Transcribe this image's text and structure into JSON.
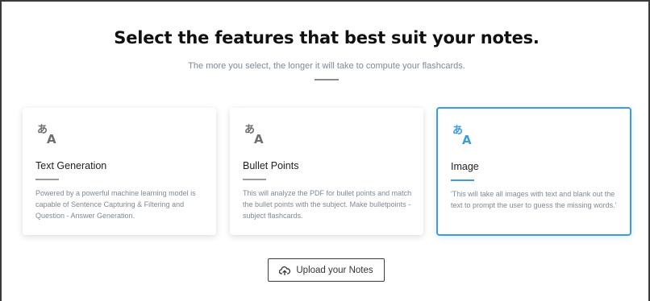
{
  "header": {
    "title": "Select the features that best suit your notes.",
    "subtitle": "The more you select, the longer it will take to compute your flashcards."
  },
  "features": [
    {
      "title": "Text Generation",
      "description": "Powered by a powerful machine learning model is capable of Sentence Capturing & Filtering and Question - Answer Generation.",
      "icon": "translate-icon",
      "selected": false
    },
    {
      "title": "Bullet Points",
      "description": "This will analyze the PDF for bullet points and match the bullet points with the subject. Make bulletpoints - subject flashcards.",
      "icon": "translate-icon",
      "selected": false
    },
    {
      "title": "Image",
      "description": "'This will take all images with text and blank out the text to prompt the user to guess the missing words.'",
      "icon": "translate-icon",
      "selected": true
    }
  ],
  "upload": {
    "label": "Upload your Notes",
    "icon": "cloud-upload-icon"
  },
  "colors": {
    "accent": "#3d9be0",
    "icon_default": "#6e6e6e",
    "text_muted": "#7e8a96"
  }
}
